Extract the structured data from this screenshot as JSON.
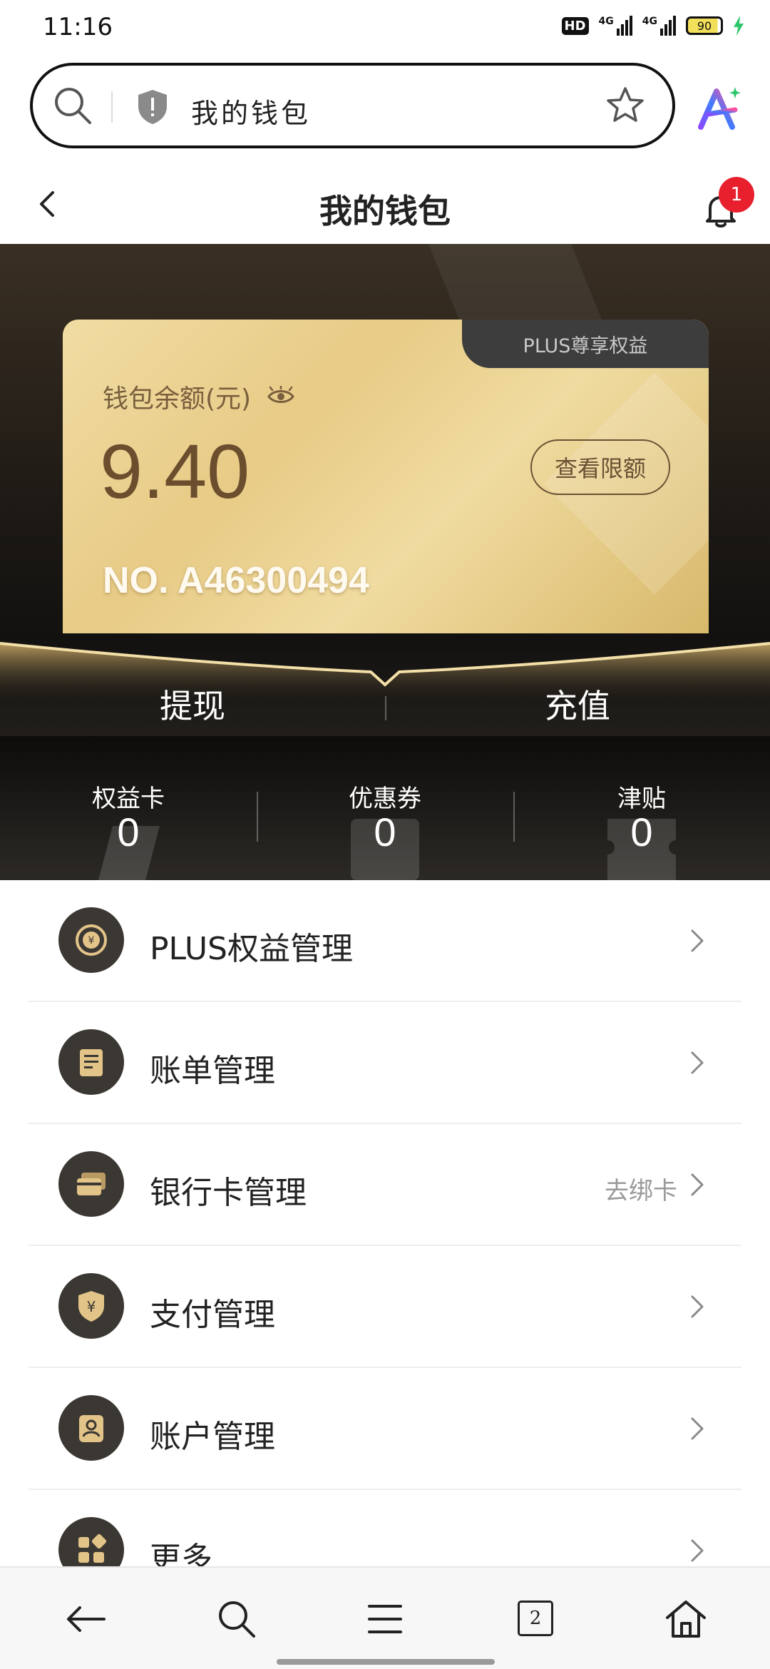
{
  "status_bar": {
    "time": "11:16",
    "network_hd": "HD",
    "signal1": "4G",
    "signal2": "4G",
    "battery": "90"
  },
  "browser": {
    "url_text": "我的钱包"
  },
  "header": {
    "title": "我的钱包",
    "notification_count": "1"
  },
  "card": {
    "tab_label": "PLUS尊享权益",
    "balance_label": "钱包余额(元)",
    "balance": "9.40",
    "limit_button": "查看限额",
    "card_number": "NO. A46300494"
  },
  "actions": {
    "withdraw": "提现",
    "recharge": "充值"
  },
  "stats": [
    {
      "label": "权益卡",
      "value": "0"
    },
    {
      "label": "优惠券",
      "value": "0"
    },
    {
      "label": "津贴",
      "value": "0"
    }
  ],
  "menu": [
    {
      "label": "PLUS权益管理",
      "extra": "",
      "icon": "plus-coin-icon"
    },
    {
      "label": "账单管理",
      "extra": "",
      "icon": "bill-icon"
    },
    {
      "label": "银行卡管理",
      "extra": "去绑卡",
      "icon": "bank-card-icon"
    },
    {
      "label": "支付管理",
      "extra": "",
      "icon": "payment-shield-icon"
    },
    {
      "label": "账户管理",
      "extra": "",
      "icon": "account-icon"
    },
    {
      "label": "更多",
      "extra": "",
      "icon": "more-grid-icon"
    }
  ],
  "bottom_nav": {
    "tab_count": "2"
  },
  "colors": {
    "gold": "#e7cb86",
    "dark": "#121110",
    "badge": "#e8202d"
  }
}
